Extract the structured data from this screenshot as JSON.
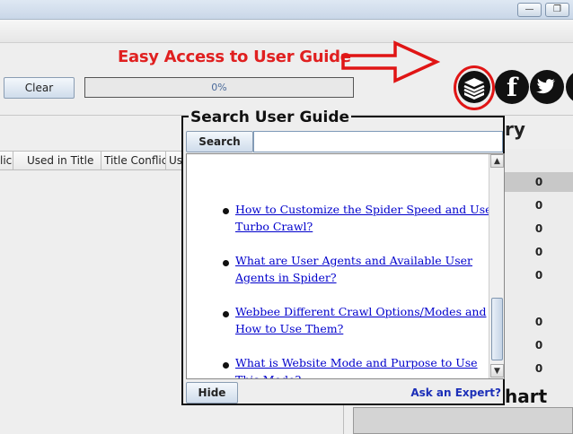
{
  "window": {
    "minimize_glyph": "—",
    "restore_glyph": "❐"
  },
  "annotation": {
    "text": "Easy Access to User Guide",
    "color": "#e02020"
  },
  "toolbar": {
    "clear_label": "Clear",
    "progress_text": "0%",
    "progress_value": 0
  },
  "social": {
    "facebook": "f",
    "twitter": "🐦",
    "user_guide_icon": "book-stack-icon"
  },
  "table": {
    "columns": [
      "licit",
      "Used in Title",
      "Title Conflict",
      "Us"
    ]
  },
  "summary": {
    "heading": "ry",
    "values": [
      "0",
      "0",
      "0",
      "0",
      "0",
      "0",
      "0",
      "0"
    ],
    "chart_heading": "hart"
  },
  "guide": {
    "title": "Search User Guide",
    "search_label": "Search",
    "search_value": "",
    "results": [
      "How to Customize the Spider Speed and Use Turbo Crawl?",
      "What are User Agents and Available User Agents in Spider?",
      "Webbee Different Crawl Options/Modes and How to Use Them?",
      "What is Website Mode and Purpose to Use This Mode?"
    ],
    "hide_label": "Hide",
    "expert_link": "Ask an Expert?"
  }
}
